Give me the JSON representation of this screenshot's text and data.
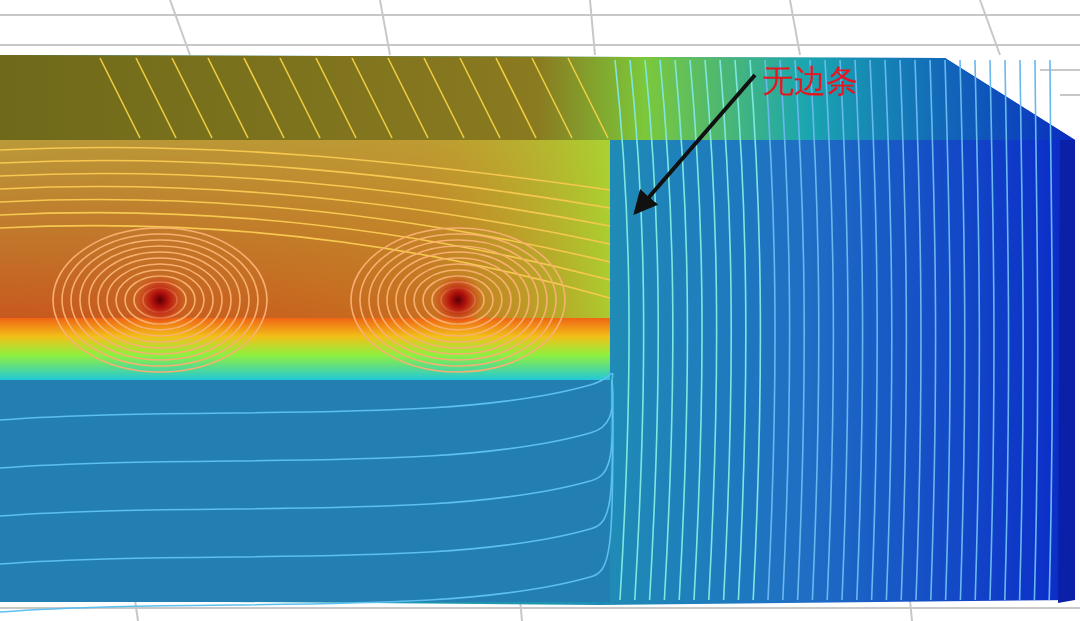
{
  "annotation": {
    "text": "无边条"
  }
}
